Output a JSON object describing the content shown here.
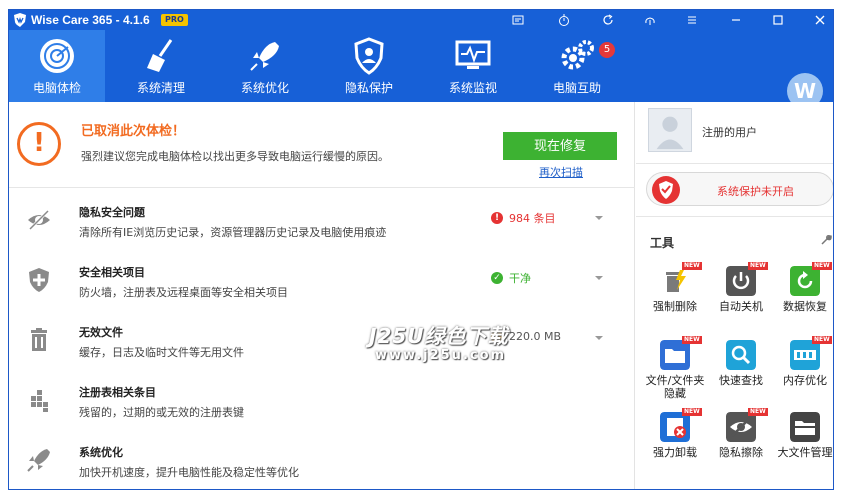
{
  "window": {
    "title": "Wise Care 365 - 4.1.6",
    "edition_badge": "PRO",
    "title_buttons": [
      "feedback-icon",
      "timer-icon",
      "refresh-icon",
      "network-icon",
      "menu-icon",
      "minimize-icon",
      "maximize-icon",
      "close-icon"
    ]
  },
  "nav": {
    "tabs": [
      {
        "label": "电脑体检",
        "icon": "radar-icon",
        "active": true
      },
      {
        "label": "系统清理",
        "icon": "broom-icon",
        "active": false
      },
      {
        "label": "系统优化",
        "icon": "rocket-icon",
        "active": false
      },
      {
        "label": "隐私保护",
        "icon": "privacy-shield-icon",
        "active": false
      },
      {
        "label": "系统监视",
        "icon": "monitor-icon",
        "active": false
      },
      {
        "label": "电脑互助",
        "icon": "gears-icon",
        "active": false
      }
    ],
    "badge_count": "5",
    "avatar_letter": "W"
  },
  "alert": {
    "title": "已取消此次体检！",
    "description": "强烈建议您完成电脑体检以找出更多导致电脑运行缓慢的原因。",
    "fix_label": "现在修复",
    "rescan_label": "再次扫描"
  },
  "rows": [
    {
      "icon": "eye-slash-icon",
      "title": "隐私安全问题",
      "desc": "清除所有IE浏览历史记录，资源管理器历史记录及电脑使用痕迹",
      "status": "984 条目",
      "status_type": "error",
      "status_color": "#e53333"
    },
    {
      "icon": "shield-plus-icon",
      "title": "安全相关项目",
      "desc": "防火墙，注册表及远程桌面等安全相关项目",
      "status": "干净",
      "status_type": "ok",
      "status_color": "#3db232"
    },
    {
      "icon": "trash-icon",
      "title": "无效文件",
      "desc": "缓存，日志及临时文件等无用文件",
      "status": "220.0 MB",
      "status_type": "warn",
      "status_color": "#f5a623"
    },
    {
      "icon": "registry-icon",
      "title": "注册表相关条目",
      "desc": "残留的，过期的或无效的注册表键",
      "status": "",
      "status_type": "none"
    },
    {
      "icon": "rocket-small-icon",
      "title": "系统优化",
      "desc": "加快开机速度，提升电脑性能及稳定性等优化",
      "status": "",
      "status_type": "none"
    }
  ],
  "side": {
    "user_name": "注册的用户",
    "protection_text": "系统保护未开启",
    "tools_title": "工具",
    "new_label": "NEW",
    "tools": [
      {
        "label": "强制删除",
        "icon": "force-delete-icon",
        "color": "#ffffff"
      },
      {
        "label": "自动关机",
        "icon": "power-icon",
        "color": "#555555"
      },
      {
        "label": "数据恢复",
        "icon": "recovery-icon",
        "color": "#3db232"
      },
      {
        "label": "文件/文件夹隐藏",
        "icon": "folder-hide-icon",
        "color": "#2f6fd6"
      },
      {
        "label": "快速查找",
        "icon": "search-icon",
        "color": "#1fa3d8"
      },
      {
        "label": "内存优化",
        "icon": "memory-icon",
        "color": "#1fa3d8"
      },
      {
        "label": "强力卸载",
        "icon": "uninstall-icon",
        "color": "#1f6fd6"
      },
      {
        "label": "隐私擦除",
        "icon": "eye-erase-icon",
        "color": "#555555"
      },
      {
        "label": "大文件管理",
        "icon": "large-file-icon",
        "color": "#444444"
      }
    ]
  },
  "watermark": {
    "line1": "J25U绿色下载",
    "line2": "www.j25u.com"
  },
  "colors": {
    "brand_blue": "#1760d7",
    "active_tab": "#2f7ee8",
    "warning_orange": "#f26b21",
    "fix_green": "#3db232"
  }
}
